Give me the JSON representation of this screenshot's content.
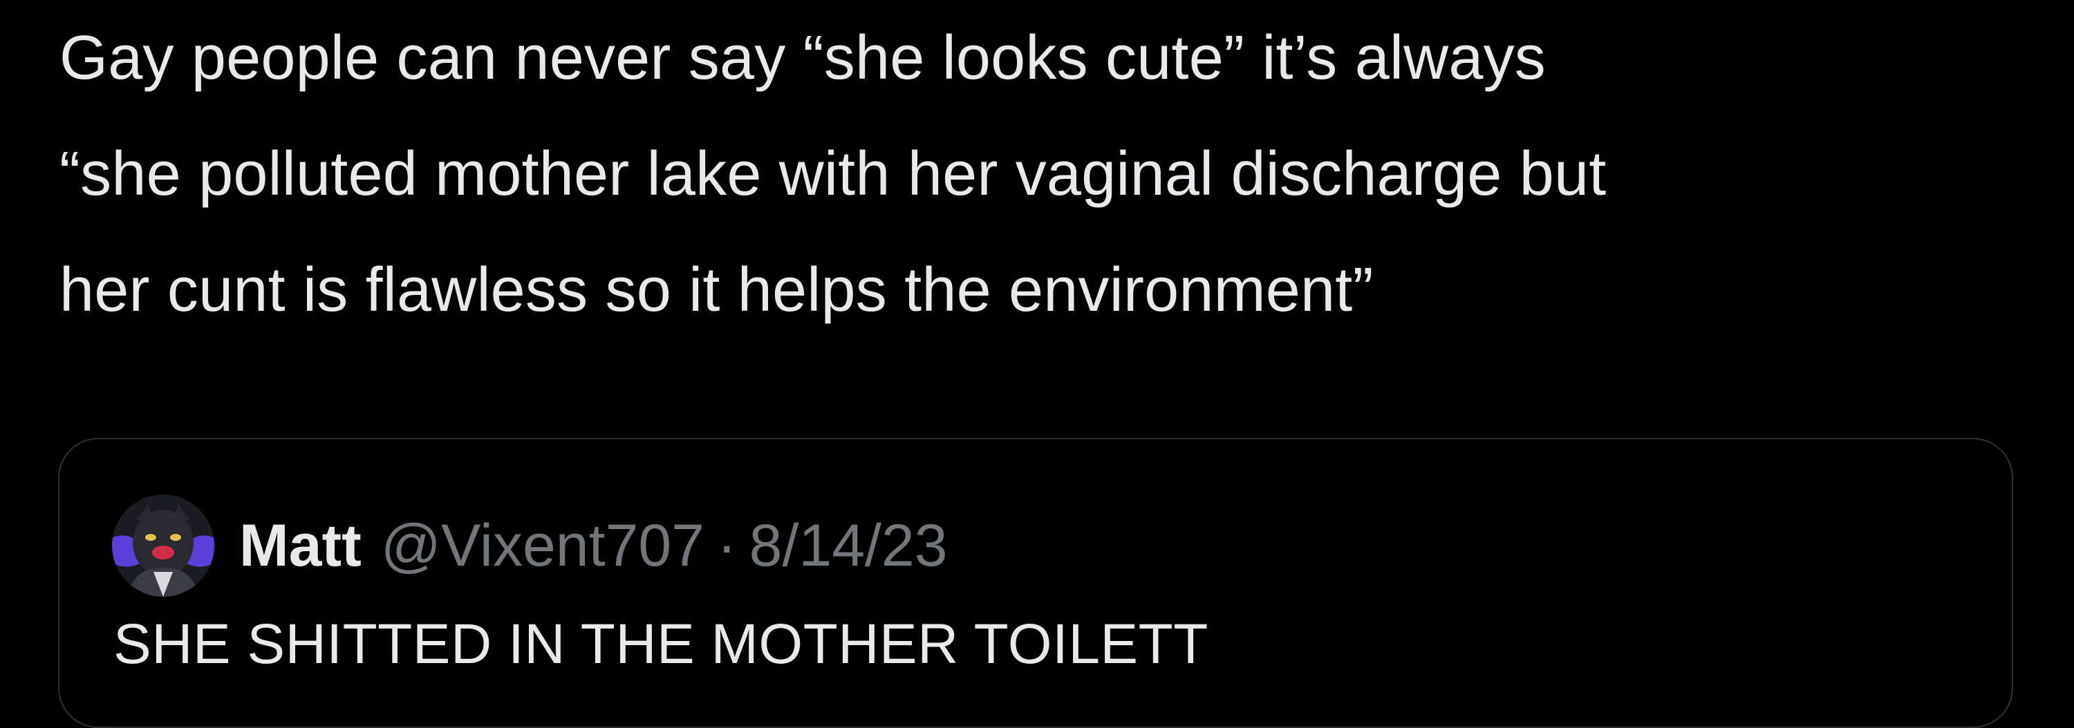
{
  "tweet": {
    "text_lines": [
      "Gay people can never say “she looks cute” it’s always",
      "“she polluted mother lake with her vaginal discharge but",
      "her cunt is flawless so it helps the environment”"
    ]
  },
  "quoted_tweet": {
    "author_name": "Matt",
    "handle": "@Vixent707",
    "separator": "·",
    "date": "8/14/23",
    "text": "SHE SHITTED IN THE MOTHER TOILETT"
  },
  "colors": {
    "background": "#000000",
    "primary_text": "#e7e9ea",
    "secondary_text": "#71767b",
    "card_border": "#2f3336"
  }
}
